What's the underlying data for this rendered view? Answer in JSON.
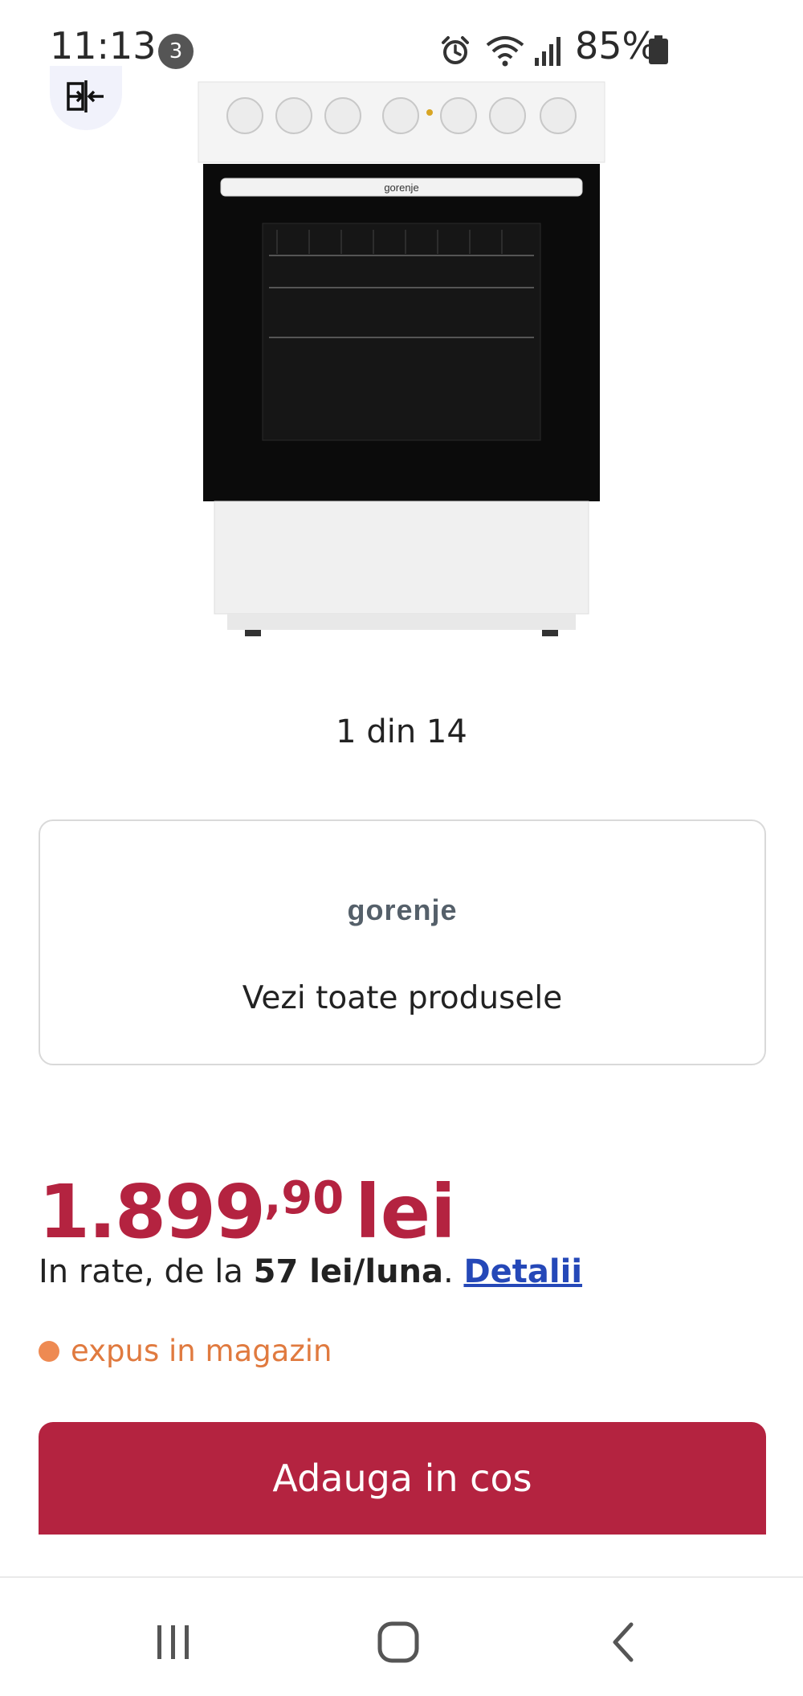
{
  "status_bar": {
    "time": "11:13",
    "notification_count": "3",
    "battery": "85%",
    "icons": [
      "alarm-icon",
      "wifi-icon",
      "signal-icon",
      "battery-icon"
    ]
  },
  "product": {
    "image_icon": "stove-image",
    "image_brand": "gorenje",
    "gallery_counter": "1 din 14"
  },
  "brand_card": {
    "logo_text": "gorenje",
    "link_label": "Vezi toate produsele"
  },
  "price": {
    "integer": "1.899",
    "decimals": ",90",
    "currency": "lei"
  },
  "installments": {
    "prefix": "In rate, de la",
    "amount": "57 lei/luna",
    "suffix": ".",
    "details_label": "Detalii"
  },
  "availability": {
    "text": "expus in magazin",
    "color": "#ee8a52"
  },
  "cart": {
    "button_label": "Adauga in cos"
  },
  "colors": {
    "accent": "#b42340",
    "link": "#2548b8"
  },
  "nav_bar": {
    "icons": [
      "recent-apps-icon",
      "home-icon",
      "back-icon"
    ]
  }
}
